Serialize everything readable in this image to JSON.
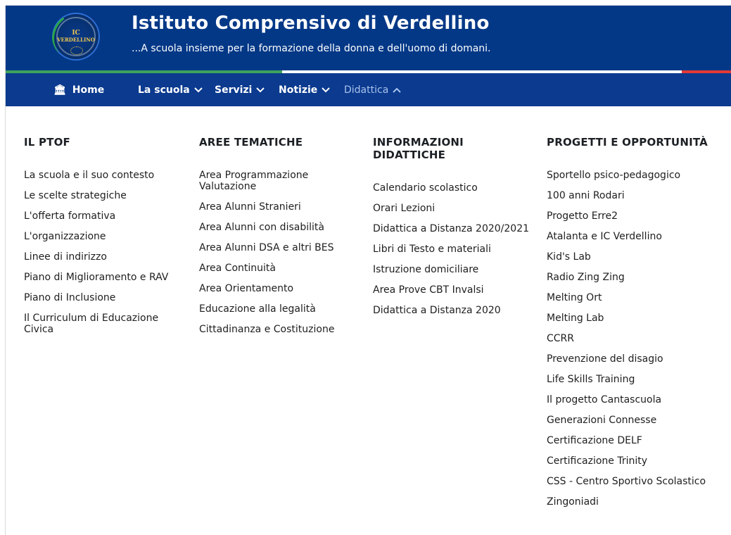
{
  "header": {
    "logo_line1": "IC",
    "logo_line2": "VERDELLINO",
    "title": "Istituto Comprensivo di Verdellino",
    "subtitle": "...A scuola insieme per la formazione della donna e dell'uomo di domani."
  },
  "colors": {
    "header_bg": "#033887",
    "nav_bg": "#0b3a8f",
    "green": "#3da35a",
    "red": "#e53935"
  },
  "nav": {
    "home_icon": "bank-icon",
    "items": [
      {
        "label": "Home"
      },
      {
        "label": "La scuola",
        "icon": "chevron-down-icon"
      },
      {
        "label": "Servizi",
        "icon": "chevron-down-icon"
      },
      {
        "label": "Notizie",
        "icon": "chevron-down-icon"
      },
      {
        "label": "Didattica",
        "icon": "chevron-up-icon",
        "active": true
      }
    ]
  },
  "menu": {
    "columns": [
      {
        "heading": "IL PTOF",
        "links": [
          "La scuola e il suo contesto",
          "Le scelte strategiche",
          "L'offerta formativa",
          "L'organizzazione",
          "Linee di indirizzo",
          "Piano di Miglioramento e RAV",
          "Piano di Inclusione",
          "Il Curriculum di Educazione Civica"
        ]
      },
      {
        "heading": "AREE TEMATICHE",
        "links": [
          "Area Programmazione Valutazione",
          "Area Alunni Stranieri",
          "Area Alunni con disabilità",
          "Area Alunni DSA e altri BES",
          "Area Continuità",
          "Area Orientamento",
          "Educazione alla legalità",
          "Cittadinanza e Costituzione"
        ]
      },
      {
        "heading": "INFORMAZIONI DIDATTICHE",
        "links": [
          "Calendario scolastico",
          "Orari Lezioni",
          "Didattica a Distanza 2020/2021",
          "Libri di Testo e materiali",
          "Istruzione domiciliare",
          "Area Prove CBT Invalsi",
          "Didattica a Distanza 2020"
        ]
      },
      {
        "heading": "PROGETTI E OPPORTUNITÀ",
        "links": [
          "Sportello psico-pedagogico",
          "100 anni Rodari",
          "Progetto Erre2",
          "Atalanta e IC Verdellino",
          "Kid's Lab",
          "Radio Zing Zing",
          "Melting Ort",
          "Melting Lab",
          "CCRR",
          "Prevenzione del disagio",
          "Life Skills Training",
          "Il progetto Cantascuola",
          "Generazioni Connesse",
          "Certificazione DELF",
          "Certificazione Trinity",
          "CSS - Centro Sportivo Scolastico",
          "Zingoniadi"
        ]
      }
    ]
  }
}
